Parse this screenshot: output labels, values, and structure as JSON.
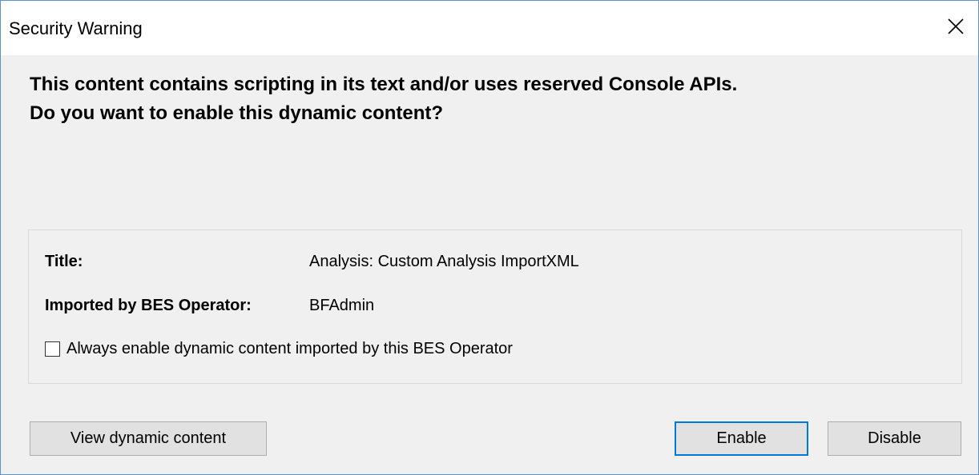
{
  "window": {
    "title": "Security Warning"
  },
  "heading": {
    "line1": "This content contains scripting in its text and/or uses reserved Console APIs.",
    "line2": "Do you want to enable this dynamic content?"
  },
  "info": {
    "title_label": "Title:",
    "title_value": "Analysis: Custom Analysis ImportXML",
    "operator_label": "Imported by BES Operator:",
    "operator_value": "BFAdmin",
    "checkbox_label": "Always enable dynamic content imported by this BES Operator",
    "checkbox_checked": false
  },
  "buttons": {
    "view_label": "View dynamic content",
    "enable_label": "Enable",
    "disable_label": "Disable"
  },
  "icons": {
    "close": "close-icon"
  },
  "colors": {
    "accent": "#0078d7",
    "window_border": "#5b8fd6",
    "background": "#f0f0f0"
  }
}
